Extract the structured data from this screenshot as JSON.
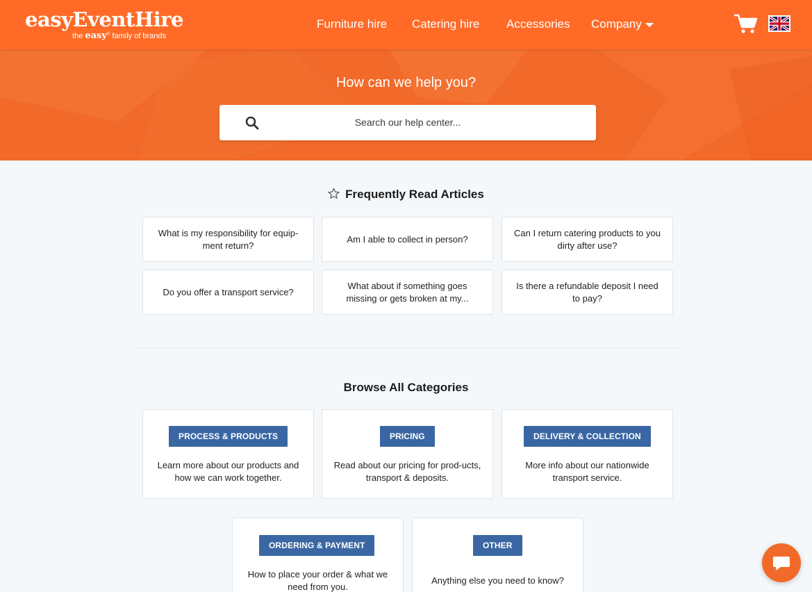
{
  "brand": {
    "name": "easyEventHire",
    "tagline_prefix": "the",
    "tagline_brand": "easy",
    "tagline_mark": "®",
    "tagline_suffix": "family of brands"
  },
  "nav": {
    "items": [
      "Furniture hire",
      "Catering hire",
      "Accessories",
      "Company"
    ]
  },
  "hero": {
    "title": "How can we help you?",
    "search_placeholder": "Search our help center..."
  },
  "frequent": {
    "title": "Frequently Read Articles",
    "articles": [
      "What is my responsibility for equip-ment return?",
      "Am I able to collect in person?",
      "Can I return catering products to you dirty after use?",
      "Do you offer a transport service?",
      "What about if something goes missing or gets broken at my...",
      "Is there a refundable deposit I need to pay?"
    ]
  },
  "categories": {
    "title": "Browse All Categories",
    "items": [
      {
        "label": "PROCESS & PRODUCTS",
        "desc": "Learn more about our products and how we can work together."
      },
      {
        "label": "PRICING",
        "desc": "Read about our pricing for prod-ucts, transport & deposits."
      },
      {
        "label": "DELIVERY & COLLECTION",
        "desc": "More info about our nationwide transport service."
      },
      {
        "label": "ORDERING & PAYMENT",
        "desc": "How to place your order & what we need from you."
      },
      {
        "label": "OTHER",
        "desc": "Anything else you need to know?"
      }
    ]
  },
  "colors": {
    "brand_orange": "#ff6b27",
    "badge_blue": "#3a67a3",
    "page_bg": "#f5f8fb"
  }
}
